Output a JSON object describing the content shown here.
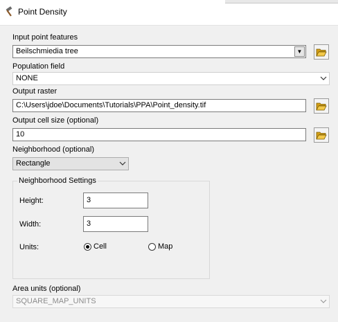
{
  "window": {
    "title": "Point Density"
  },
  "input_points": {
    "label": "Input point features",
    "value": "Beilschmiedia tree"
  },
  "population": {
    "label": "Population field",
    "value": "NONE"
  },
  "output_raster": {
    "label": "Output raster",
    "value": "C:\\Users\\jdoe\\Documents\\Tutorials\\PPA\\Point_density.tif"
  },
  "cell_size": {
    "label": "Output cell size (optional)",
    "value": "10"
  },
  "neighborhood": {
    "label": "Neighborhood (optional)",
    "value": "Rectangle",
    "settings_title": "Neighborhood Settings",
    "height_label": "Height:",
    "height_value": "3",
    "width_label": "Width:",
    "width_value": "3",
    "units_label": "Units:",
    "unit_cell": "Cell",
    "unit_map": "Map",
    "selected_unit": "Cell"
  },
  "area_units": {
    "label": "Area units (optional)",
    "value": "SQUARE_MAP_UNITS"
  },
  "icons": {
    "title": "hammer-icon",
    "browse": "folder-open-icon",
    "dropdown": "chevron-down-icon"
  }
}
